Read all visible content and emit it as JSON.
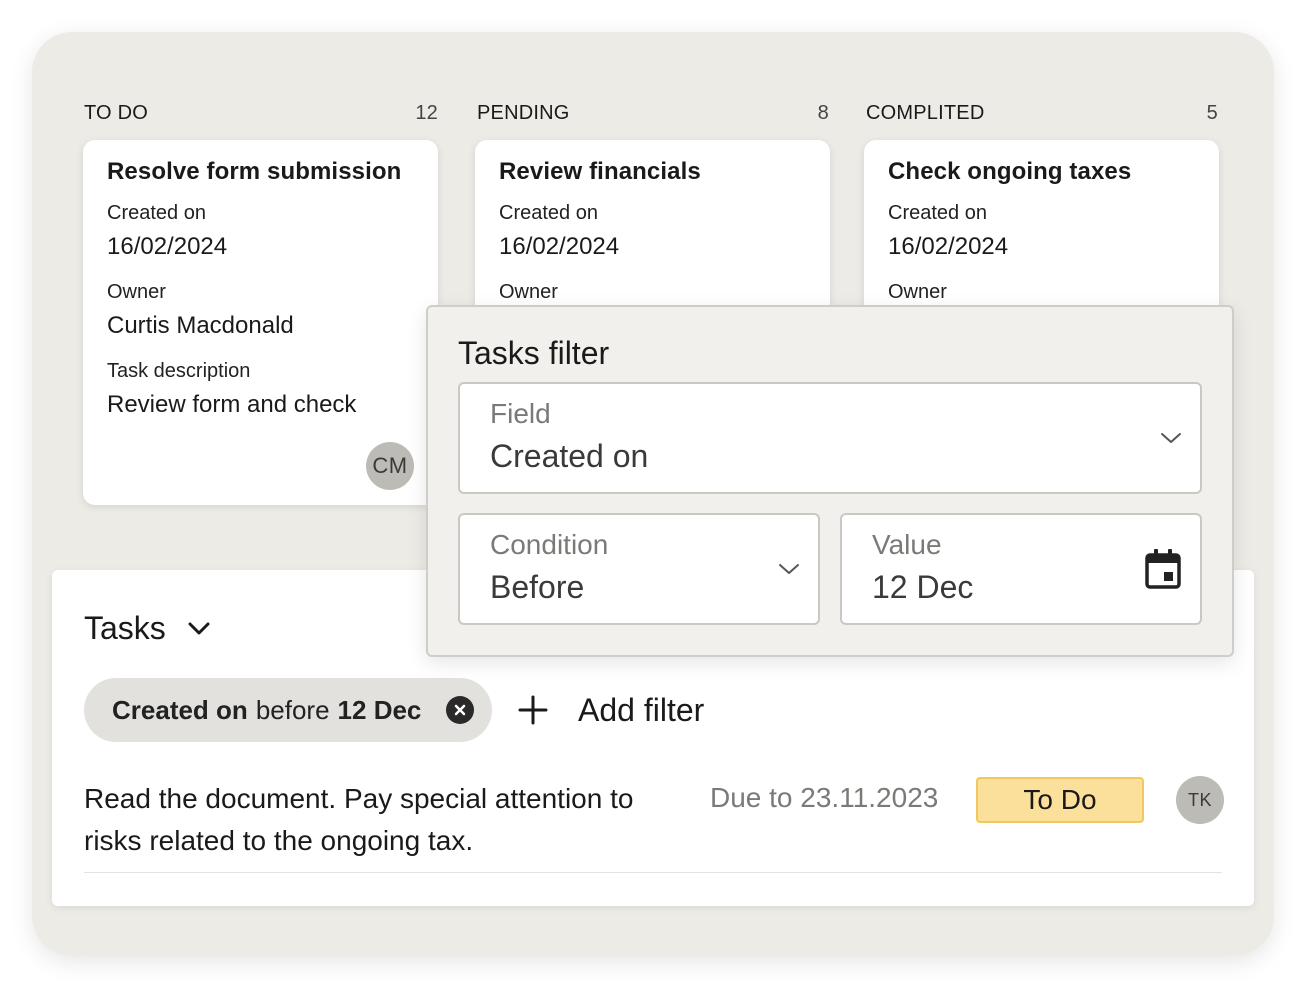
{
  "columns": [
    {
      "name": "TO DO",
      "count": "12",
      "card": {
        "title": "Resolve form submission",
        "created_label": "Created on",
        "created_value": "16/02/2024",
        "owner_label": "Owner",
        "owner_value": "Curtis Macdonald",
        "description_label": "Task description",
        "description_value": "Review form and check",
        "avatar": "CM"
      }
    },
    {
      "name": "PENDING",
      "count": "8",
      "card": {
        "title": "Review financials",
        "created_label": "Created on",
        "created_value": "16/02/2024",
        "owner_label": "Owner"
      }
    },
    {
      "name": "COMPLITED",
      "count": "5",
      "card": {
        "title": "Check ongoing taxes",
        "created_label": "Created on",
        "created_value": "16/02/2024",
        "owner_label": "Owner"
      }
    }
  ],
  "filter_popover": {
    "title": "Tasks filter",
    "field": {
      "label": "Field",
      "value": "Created on"
    },
    "condition": {
      "label": "Condition",
      "value": "Before"
    },
    "value": {
      "label": "Value",
      "value": "12 Dec"
    },
    "icons": {
      "dropdown": "chevron-down-icon",
      "calendar": "calendar-icon"
    }
  },
  "tasks": {
    "title": "Tasks",
    "chip": {
      "field": "Created on",
      "condition": "before",
      "value": "12 Dec"
    },
    "add_filter_label": "Add filter",
    "row": {
      "description": "Read the document. Pay special attention to risks related to the ongoing tax.",
      "due": "Due to 23.11.2023",
      "status": "To Do",
      "avatar": "TK"
    }
  },
  "colors": {
    "frame_bg": "#edebe6",
    "status_bg": "#fbe09c",
    "status_border": "#f2c85c",
    "chip_bg": "#e2e1dd",
    "avatar_bg": "#bdbbb6"
  }
}
